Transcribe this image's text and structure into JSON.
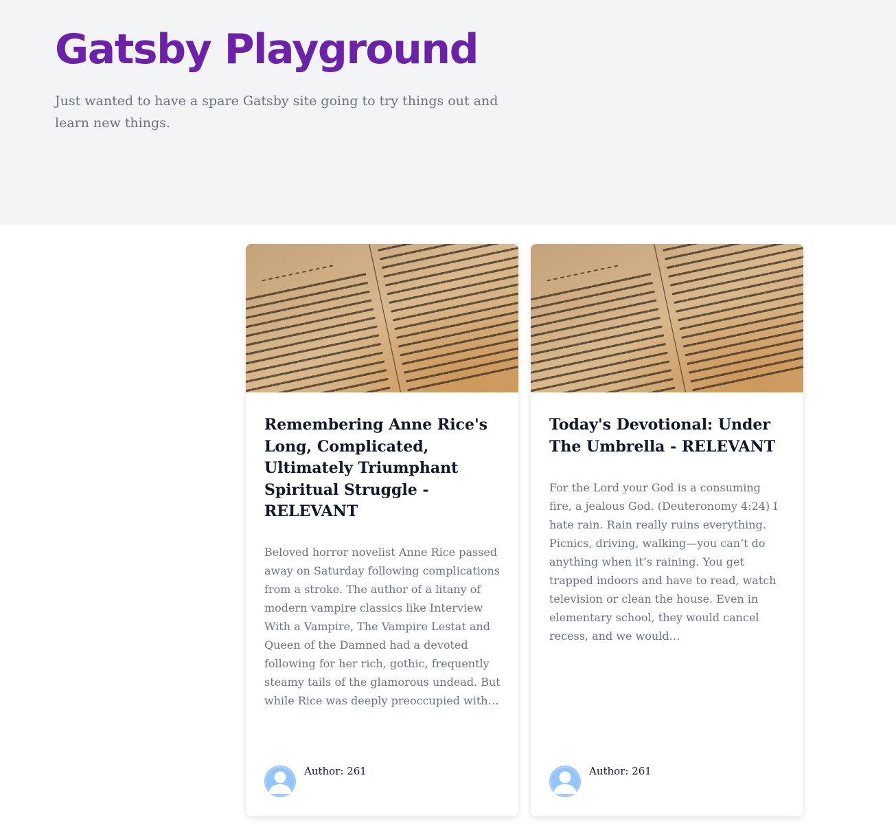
{
  "site": {
    "title": "Gatsby Playground",
    "description": "Just wanted to have a spare Gatsby site going to try things out and learn new things."
  },
  "colors": {
    "brand_purple": "#6b21a8",
    "hero_background": "#f3f4f6",
    "avatar_blue": "#93c5fd"
  },
  "posts": [
    {
      "image": "open-book-page-image",
      "title": "Remembering Anne Rice's Long, Complicated, Ultimately Triumphant Spiritual Struggle - RELEVANT",
      "excerpt": "Beloved horror novelist Anne Rice passed away on Saturday following complications from a stroke. The author of a litany of modern vampire classics like Interview With a Vampire, The Vampire Lestat and Queen of the Damned had a devoted following for her rich, gothic, frequently steamy tails of the glamorous undead. But while Rice was deeply preoccupied with…",
      "author": "Author: 261",
      "avatar_icon": "user-avatar-icon"
    },
    {
      "image": "open-book-page-image",
      "title": "Today's Devotional: Under The Umbrella - RELEVANT",
      "excerpt": "For the Lord your God is a consuming fire, a jealous God. (Deuteronomy 4:24) I hate rain. Rain really ruins everything. Picnics, driving, walking—you can’t do anything when it’s raining. You get trapped indoors and have to read, watch television or clean the house. Even in elementary school, they would cancel recess, and we would…",
      "author": "Author: 261",
      "avatar_icon": "user-avatar-icon"
    }
  ]
}
